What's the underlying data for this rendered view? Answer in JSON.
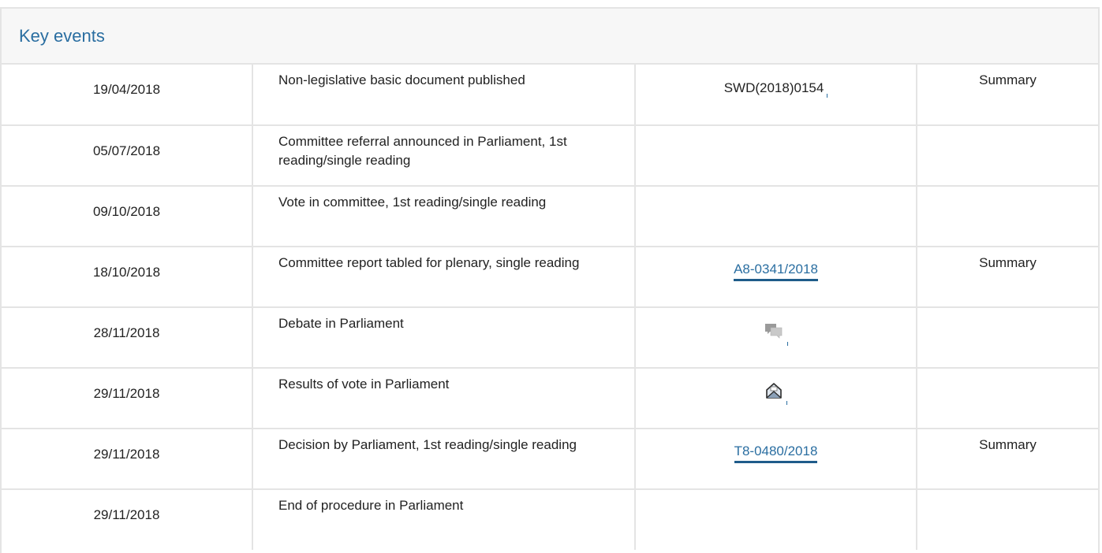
{
  "panel": {
    "title": "Key events"
  },
  "rows": [
    {
      "date": "19/04/2018",
      "event": "Non-legislative basic document published",
      "reference": "SWD(2018)0154",
      "reference_type": "text",
      "summary": "Summary"
    },
    {
      "date": "05/07/2018",
      "event": "Committee referral announced in Parliament, 1st reading/single reading",
      "reference": "",
      "reference_type": "none",
      "summary": ""
    },
    {
      "date": "09/10/2018",
      "event": "Vote in committee, 1st reading/single reading",
      "reference": "",
      "reference_type": "none",
      "summary": ""
    },
    {
      "date": "18/10/2018",
      "event": "Committee report tabled for plenary, single reading",
      "reference": "A8-0341/2018",
      "reference_type": "link",
      "summary": "Summary"
    },
    {
      "date": "28/11/2018",
      "event": "Debate in Parliament",
      "reference": "",
      "reference_type": "debate-icon",
      "summary": ""
    },
    {
      "date": "29/11/2018",
      "event": "Results of vote in Parliament",
      "reference": "",
      "reference_type": "vote-results-icon",
      "summary": ""
    },
    {
      "date": "29/11/2018",
      "event": "Decision by Parliament, 1st reading/single reading",
      "reference": "T8-0480/2018",
      "reference_type": "link",
      "summary": "Summary"
    },
    {
      "date": "29/11/2018",
      "event": "End of procedure in Parliament",
      "reference": "",
      "reference_type": "none",
      "summary": ""
    }
  ],
  "colors": {
    "link": "#2a6ea1",
    "border": "#e4e4e4",
    "header_bg": "#f7f7f7"
  }
}
